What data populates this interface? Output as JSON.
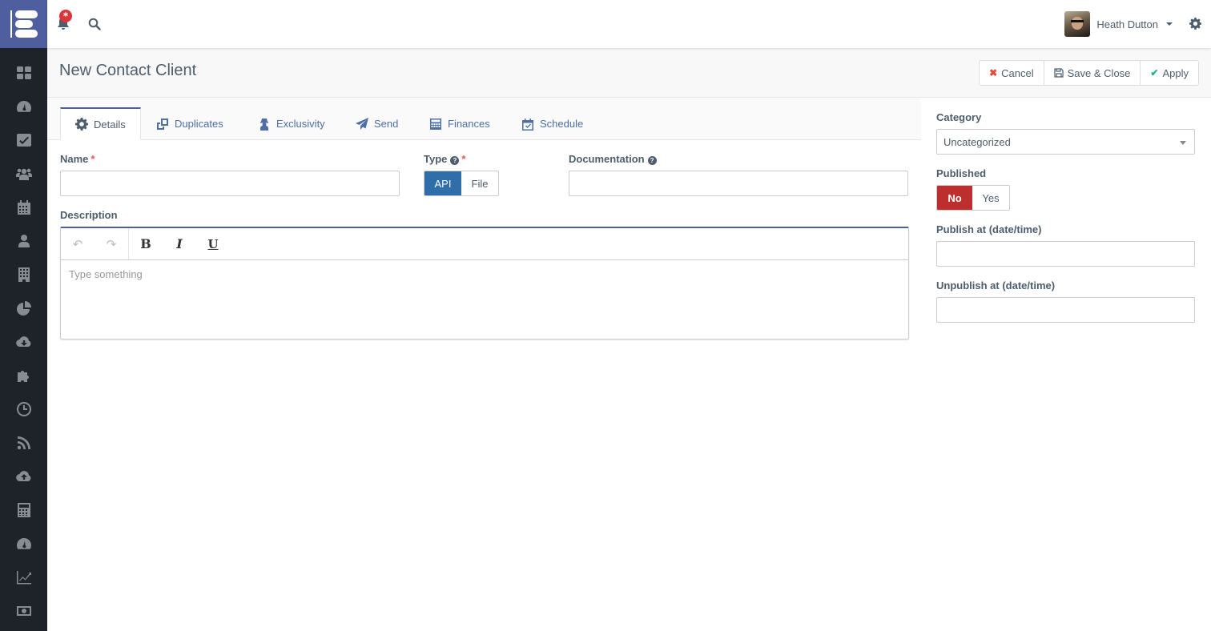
{
  "app": {
    "notification_badge": "*",
    "user_name": "Heath Dutton"
  },
  "sidebar": {
    "items": [
      {
        "icon": "dashboard-grid-icon"
      },
      {
        "icon": "speedometer-icon"
      },
      {
        "icon": "check-square-icon"
      },
      {
        "icon": "users-icon"
      },
      {
        "icon": "calendar-icon"
      },
      {
        "icon": "user-icon"
      },
      {
        "icon": "building-icon"
      },
      {
        "icon": "pie-chart-icon"
      },
      {
        "icon": "cloud-download-icon"
      },
      {
        "icon": "puzzle-icon"
      },
      {
        "icon": "clock-icon"
      },
      {
        "icon": "rss-icon"
      },
      {
        "icon": "cloud-upload-icon"
      },
      {
        "icon": "calculator-icon"
      },
      {
        "icon": "speedometer-icon"
      },
      {
        "icon": "line-chart-icon"
      },
      {
        "icon": "money-icon"
      }
    ]
  },
  "header": {
    "title": "New Contact Client",
    "buttons": {
      "cancel": "Cancel",
      "save_close": "Save & Close",
      "apply": "Apply"
    }
  },
  "tabs": [
    {
      "label": "Details",
      "icon": "gear-icon",
      "active": true
    },
    {
      "label": "Duplicates",
      "icon": "clone-icon"
    },
    {
      "label": "Exclusivity",
      "icon": "user-secret-icon"
    },
    {
      "label": "Send",
      "icon": "paper-plane-icon"
    },
    {
      "label": "Finances",
      "icon": "calculator-icon"
    },
    {
      "label": "Schedule",
      "icon": "calendar-check-icon"
    }
  ],
  "form": {
    "name": {
      "label": "Name",
      "required": "*",
      "value": ""
    },
    "type": {
      "label": "Type",
      "required": "*",
      "options": [
        "API",
        "File"
      ],
      "selected": "API"
    },
    "documentation": {
      "label": "Documentation",
      "value": ""
    },
    "description": {
      "label": "Description",
      "placeholder": "Type something",
      "toolbar": [
        "undo",
        "redo",
        "B",
        "I",
        "U"
      ]
    }
  },
  "side_panel": {
    "category": {
      "label": "Category",
      "value": "Uncategorized"
    },
    "published": {
      "label": "Published",
      "options": [
        "No",
        "Yes"
      ],
      "selected": "No"
    },
    "publish_at": {
      "label": "Publish at (date/time)",
      "value": ""
    },
    "unpublish_at": {
      "label": "Unpublish at (date/time)",
      "value": ""
    }
  },
  "colors": {
    "brand": "#4e5e9e",
    "sidebar_bg": "#1e2229",
    "type_selected": "#2f6ea9",
    "published_no": "#bd2e2e",
    "cancel_icon": "#e8473c",
    "apply_icon": "#1eb48a",
    "tab_link": "#4e6fa3"
  }
}
